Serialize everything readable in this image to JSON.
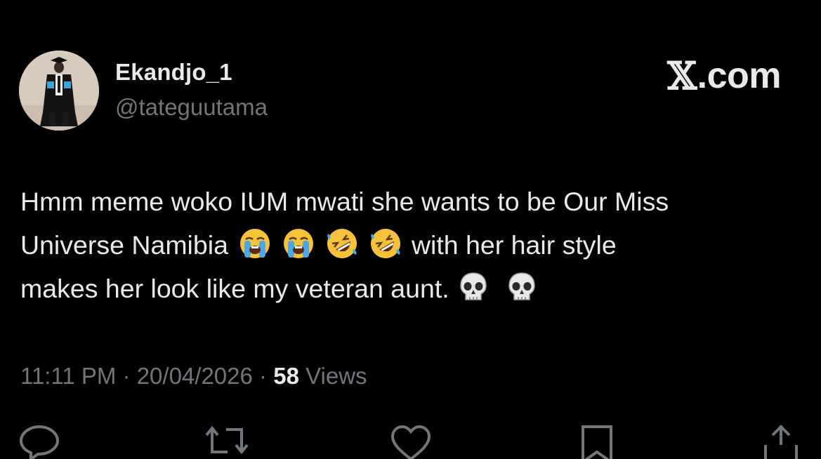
{
  "tweet": {
    "author": {
      "display_name": "Ekandjo_1",
      "handle": "@tateguutama"
    },
    "brand": {
      "text": ".com"
    },
    "text": {
      "line1": "Hmm meme woko IUM mwati she wants to be Our Miss",
      "line2_start": "Universe Namibia",
      "line2_end": "with her hair style",
      "line3_start": "makes her look like my veteran aunt."
    },
    "emojis": [
      "loudly-crying-face",
      "loudly-crying-face",
      "rolling-on-floor-laughing",
      "rolling-on-floor-laughing",
      "skull",
      "skull"
    ],
    "meta": {
      "time": "11:11 PM",
      "date": "20/04/2026",
      "views_count": "58",
      "views_label": "Views"
    },
    "actions": [
      "reply-icon",
      "retweet-icon",
      "like-icon",
      "bookmark-icon",
      "share-icon"
    ]
  },
  "colors": {
    "background": "#000000",
    "primary_text": "#e7e9ea",
    "secondary_text": "#71767b"
  }
}
